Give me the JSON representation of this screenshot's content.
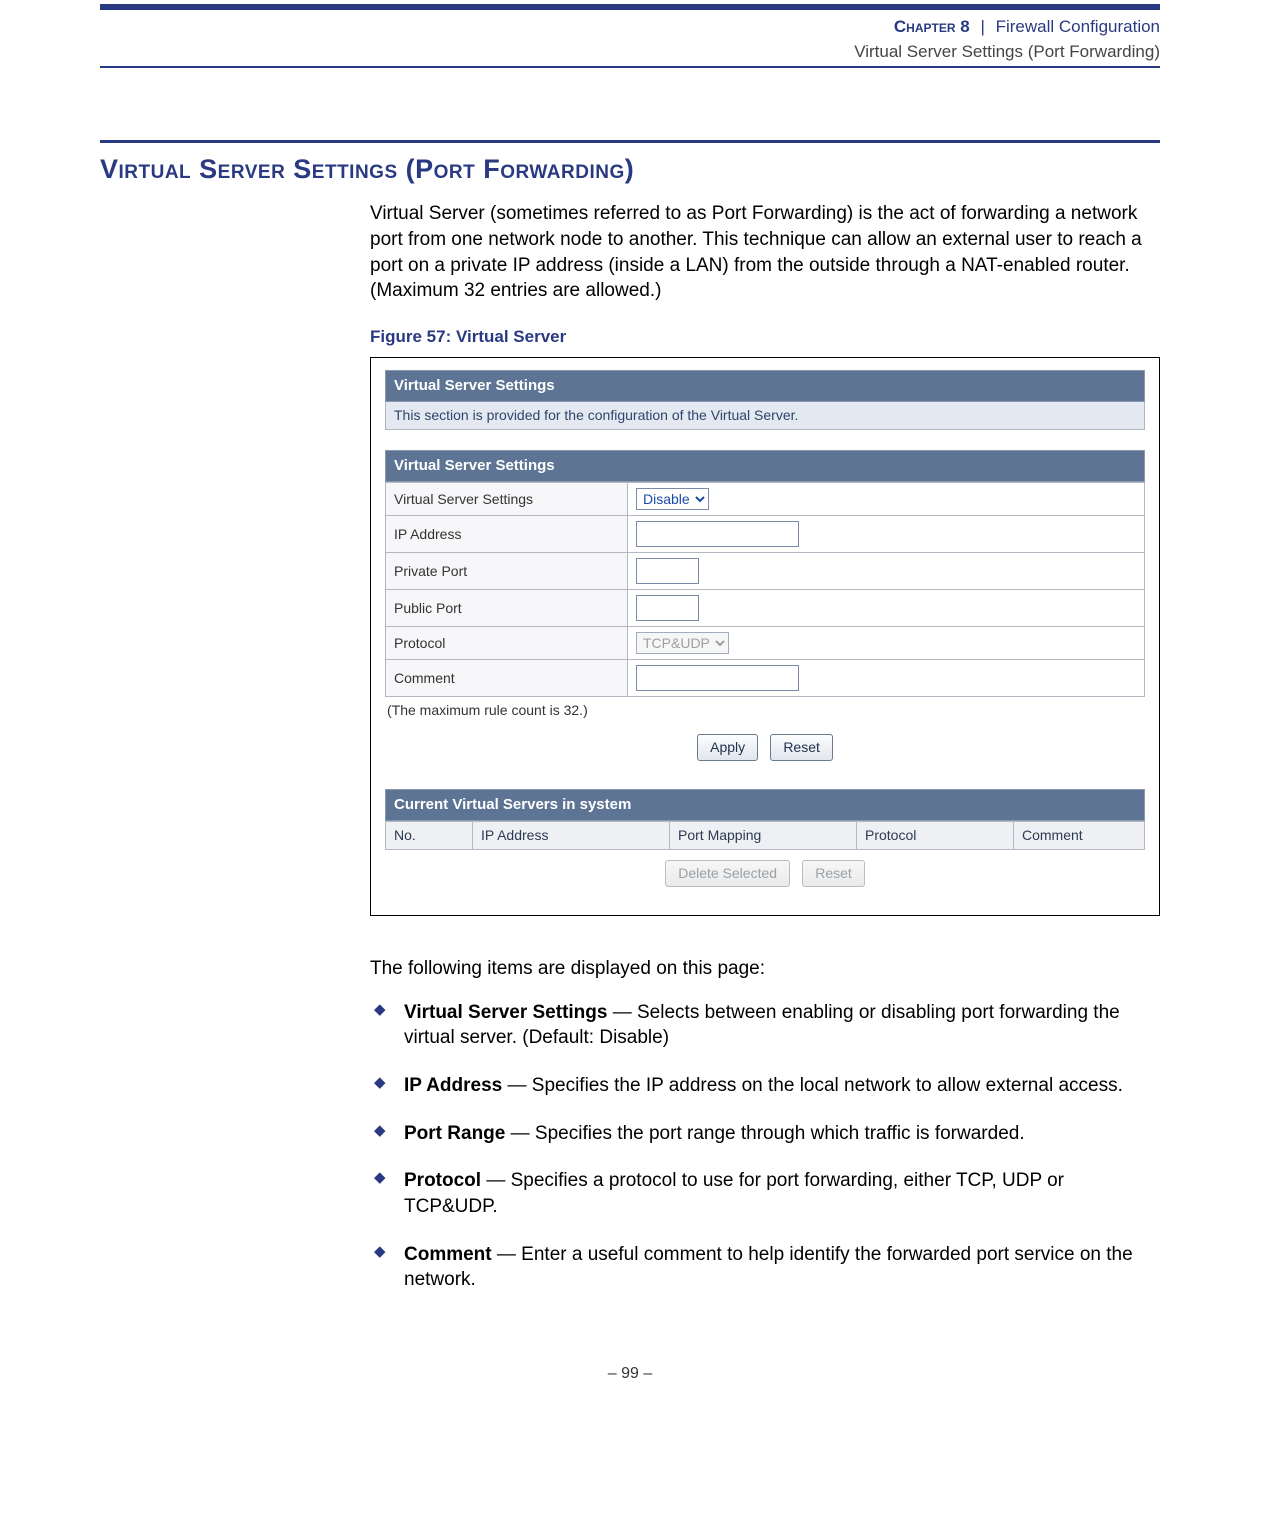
{
  "header": {
    "chapter_prefix": "Chapter 8",
    "separator": "|",
    "chapter_title": "Firewall Configuration",
    "subtitle": "Virtual Server Settings (Port Forwarding)"
  },
  "section_title": "Virtual Server Settings (Port Forwarding)",
  "intro": "Virtual Server (sometimes referred to as Port Forwarding) is the act of forwarding a network port from one network node to another. This technique can allow an external user to reach a port on a private IP address (inside a LAN) from the outside through a NAT-enabled router. (Maximum 32 entries are allowed.)",
  "figure_caption": "Figure 57:  Virtual Server",
  "ui": {
    "panel1_title": "Virtual Server Settings",
    "panel1_desc": "This section is provided for the configuration of the Virtual Server.",
    "panel2_title": "Virtual Server Settings",
    "rows": {
      "vss_label": "Virtual Server Settings",
      "vss_value": "Disable",
      "ip_label": "IP Address",
      "priv_label": "Private Port",
      "pub_label": "Public Port",
      "proto_label": "Protocol",
      "proto_value": "TCP&UDP",
      "comment_label": "Comment"
    },
    "note": "(The maximum rule count is 32.)",
    "apply": "Apply",
    "reset": "Reset",
    "current_title": "Current Virtual Servers in system",
    "cols": {
      "no": "No.",
      "ip": "IP Address",
      "pm": "Port Mapping",
      "proto": "Protocol",
      "comment": "Comment"
    },
    "delete": "Delete Selected",
    "reset2": "Reset"
  },
  "lead": "The following items are displayed on this page:",
  "items": [
    {
      "term": "Virtual Server Settings",
      "desc": " — Selects between enabling or disabling port forwarding the virtual server. (Default: Disable)"
    },
    {
      "term": "IP Address",
      "desc": " — Specifies the IP address on the local network to allow external access."
    },
    {
      "term": "Port Range",
      "desc": " — Specifies the port range through which traffic is forwarded."
    },
    {
      "term": "Protocol",
      "desc": " — Specifies a protocol to use for port forwarding, either TCP, UDP or TCP&UDP."
    },
    {
      "term": "Comment",
      "desc": " — Enter a useful comment to help identify the forwarded port service on the network."
    }
  ],
  "footer": "–  99  –"
}
